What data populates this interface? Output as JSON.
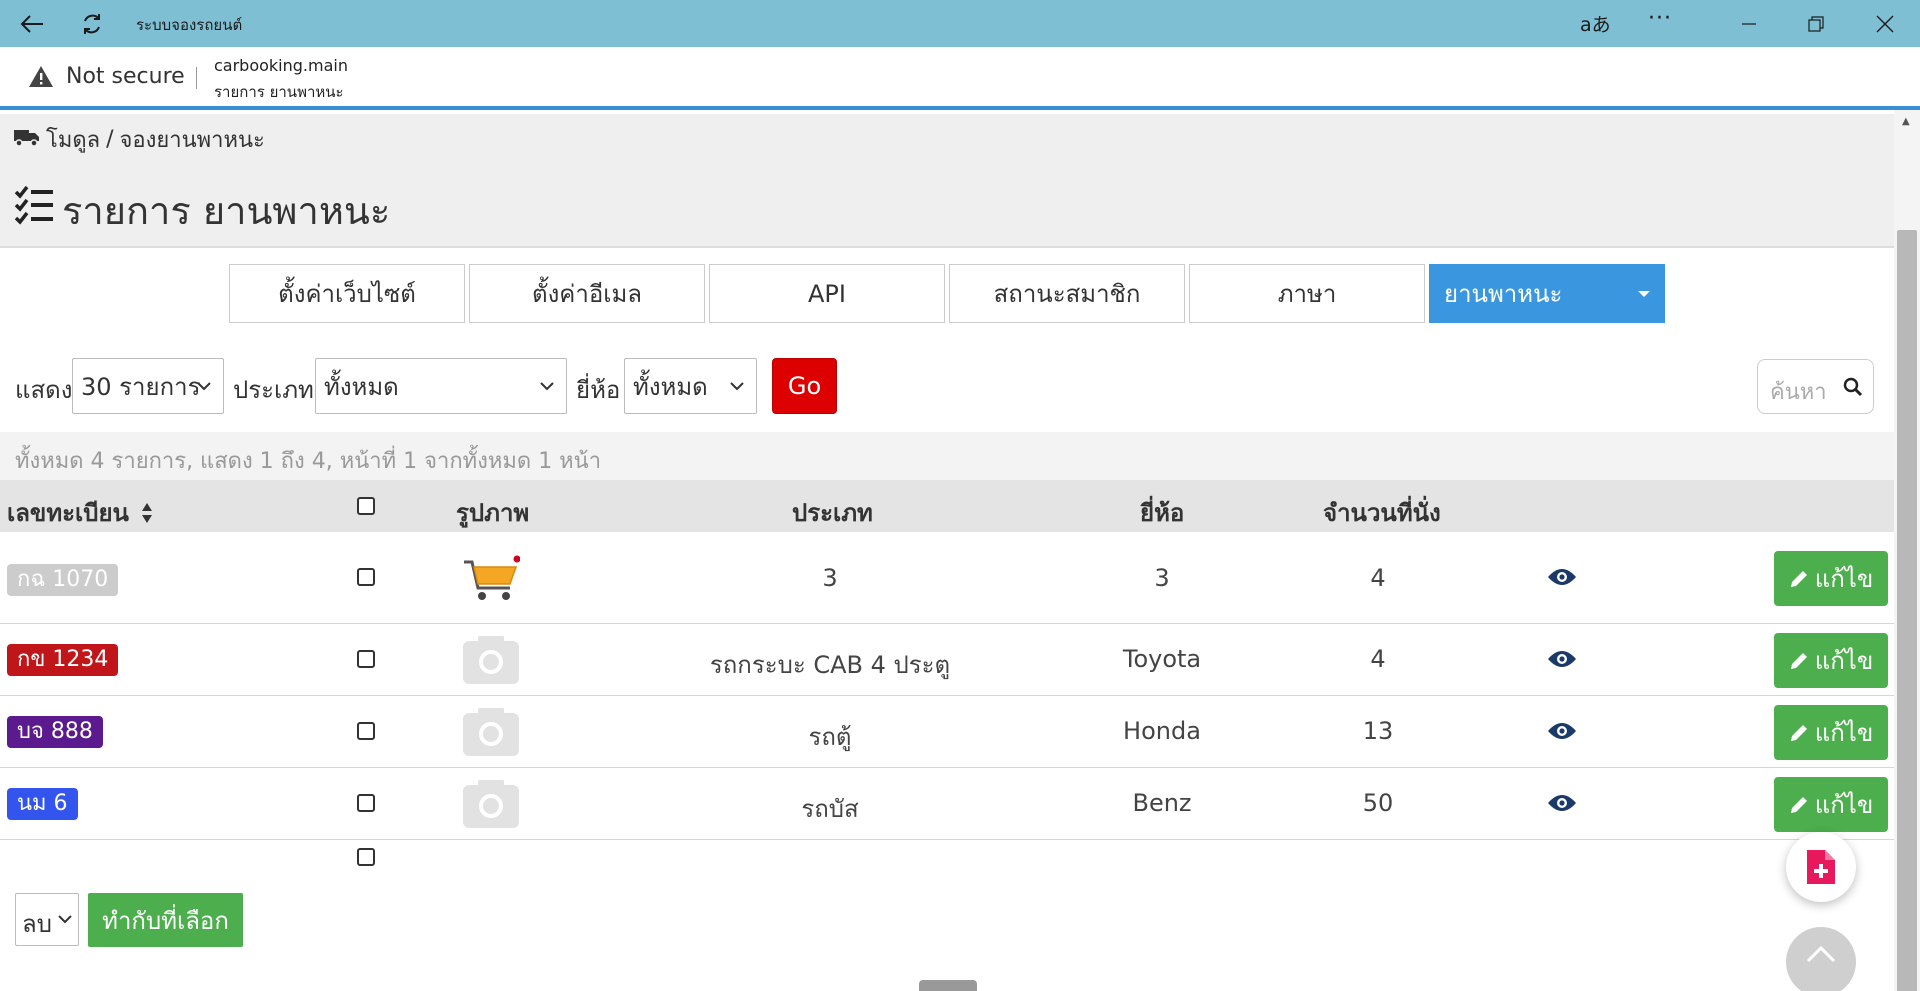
{
  "titlebar": {
    "title": "ระบบจองรถยนต์",
    "read_aloud": "aあ",
    "more": "···"
  },
  "address": {
    "security": "Not secure",
    "host": "carbooking.main",
    "page_title": "รายการ ยานพาหนะ"
  },
  "breadcrumb": {
    "module": "โมดูล",
    "separator": "/",
    "current": "จองยานพาหนะ"
  },
  "page_title": "รายการ ยานพาหนะ",
  "tabs": [
    {
      "label": "ตั้งค่าเว็บไซต์",
      "active": false
    },
    {
      "label": "ตั้งค่าอีเมล",
      "active": false
    },
    {
      "label": "API",
      "active": false
    },
    {
      "label": "สถานะสมาชิก",
      "active": false
    },
    {
      "label": "ภาษา",
      "active": false
    },
    {
      "label": "ยานพาหนะ",
      "active": true
    }
  ],
  "filters": {
    "show_label": "แสดง",
    "show_value": "30 รายการ",
    "type_label": "ประเภท",
    "type_value": "ทั้งหมด",
    "brand_label": "ยี่ห้อ",
    "brand_value": "ทั้งหมด",
    "go_label": "Go",
    "search_placeholder": "ค้นหา"
  },
  "summary": "ทั้งหมด 4 รายการ, แสดง 1 ถึง 4, หน้าที่ 1 จากทั้งหมด 1 หน้า",
  "table": {
    "headers": {
      "plate": "เลขทะเบียน",
      "image": "รูปภาพ",
      "type": "ประเภท",
      "brand": "ยี่ห้อ",
      "seats": "จำนวนที่นั่ง"
    },
    "edit_label": "แก้ไข",
    "rows": [
      {
        "plate": "กฉ 1070",
        "plate_color": "#cccccc",
        "image": "cart-image",
        "type": "3",
        "brand": "3",
        "seats": "4"
      },
      {
        "plate": "กข 1234",
        "plate_color": "#c0161a",
        "image": "camera-placeholder",
        "type": "รถกระบะ CAB 4 ประตู",
        "brand": "Toyota",
        "seats": "4"
      },
      {
        "plate": "บจ 888",
        "plate_color": "#5b1a8e",
        "image": "camera-placeholder",
        "type": "รถตู้",
        "brand": "Honda",
        "seats": "13"
      },
      {
        "plate": "นม 6",
        "plate_color": "#3355ee",
        "image": "camera-placeholder",
        "type": "รถบัส",
        "brand": "Benz",
        "seats": "50"
      }
    ]
  },
  "bulk": {
    "action_value": "ลบ",
    "apply_label": "ทำกับที่เลือก"
  },
  "colors": {
    "titlebar": "#7fbfd4",
    "tab_active": "#3a97df",
    "go_button": "#dd0000",
    "edit_button": "#4cae4c",
    "eye_icon": "#1a3a6a",
    "fab_icon": "#e8185c"
  }
}
